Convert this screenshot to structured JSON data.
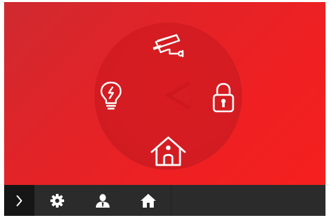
{
  "colors": {
    "primary_red": "#e32327",
    "dial_red": "#d31c22",
    "bar_dark": "#2b2b2b",
    "expand_dark": "#161616",
    "icon_white": "#ffffff"
  },
  "dial": {
    "icons": [
      "security-camera-icon",
      "light-bulb-icon",
      "padlock-icon",
      "house-icon"
    ]
  },
  "bottom_bar": {
    "icons": [
      "chevron-right-icon",
      "gear-icon",
      "person-icon",
      "home-icon"
    ]
  }
}
